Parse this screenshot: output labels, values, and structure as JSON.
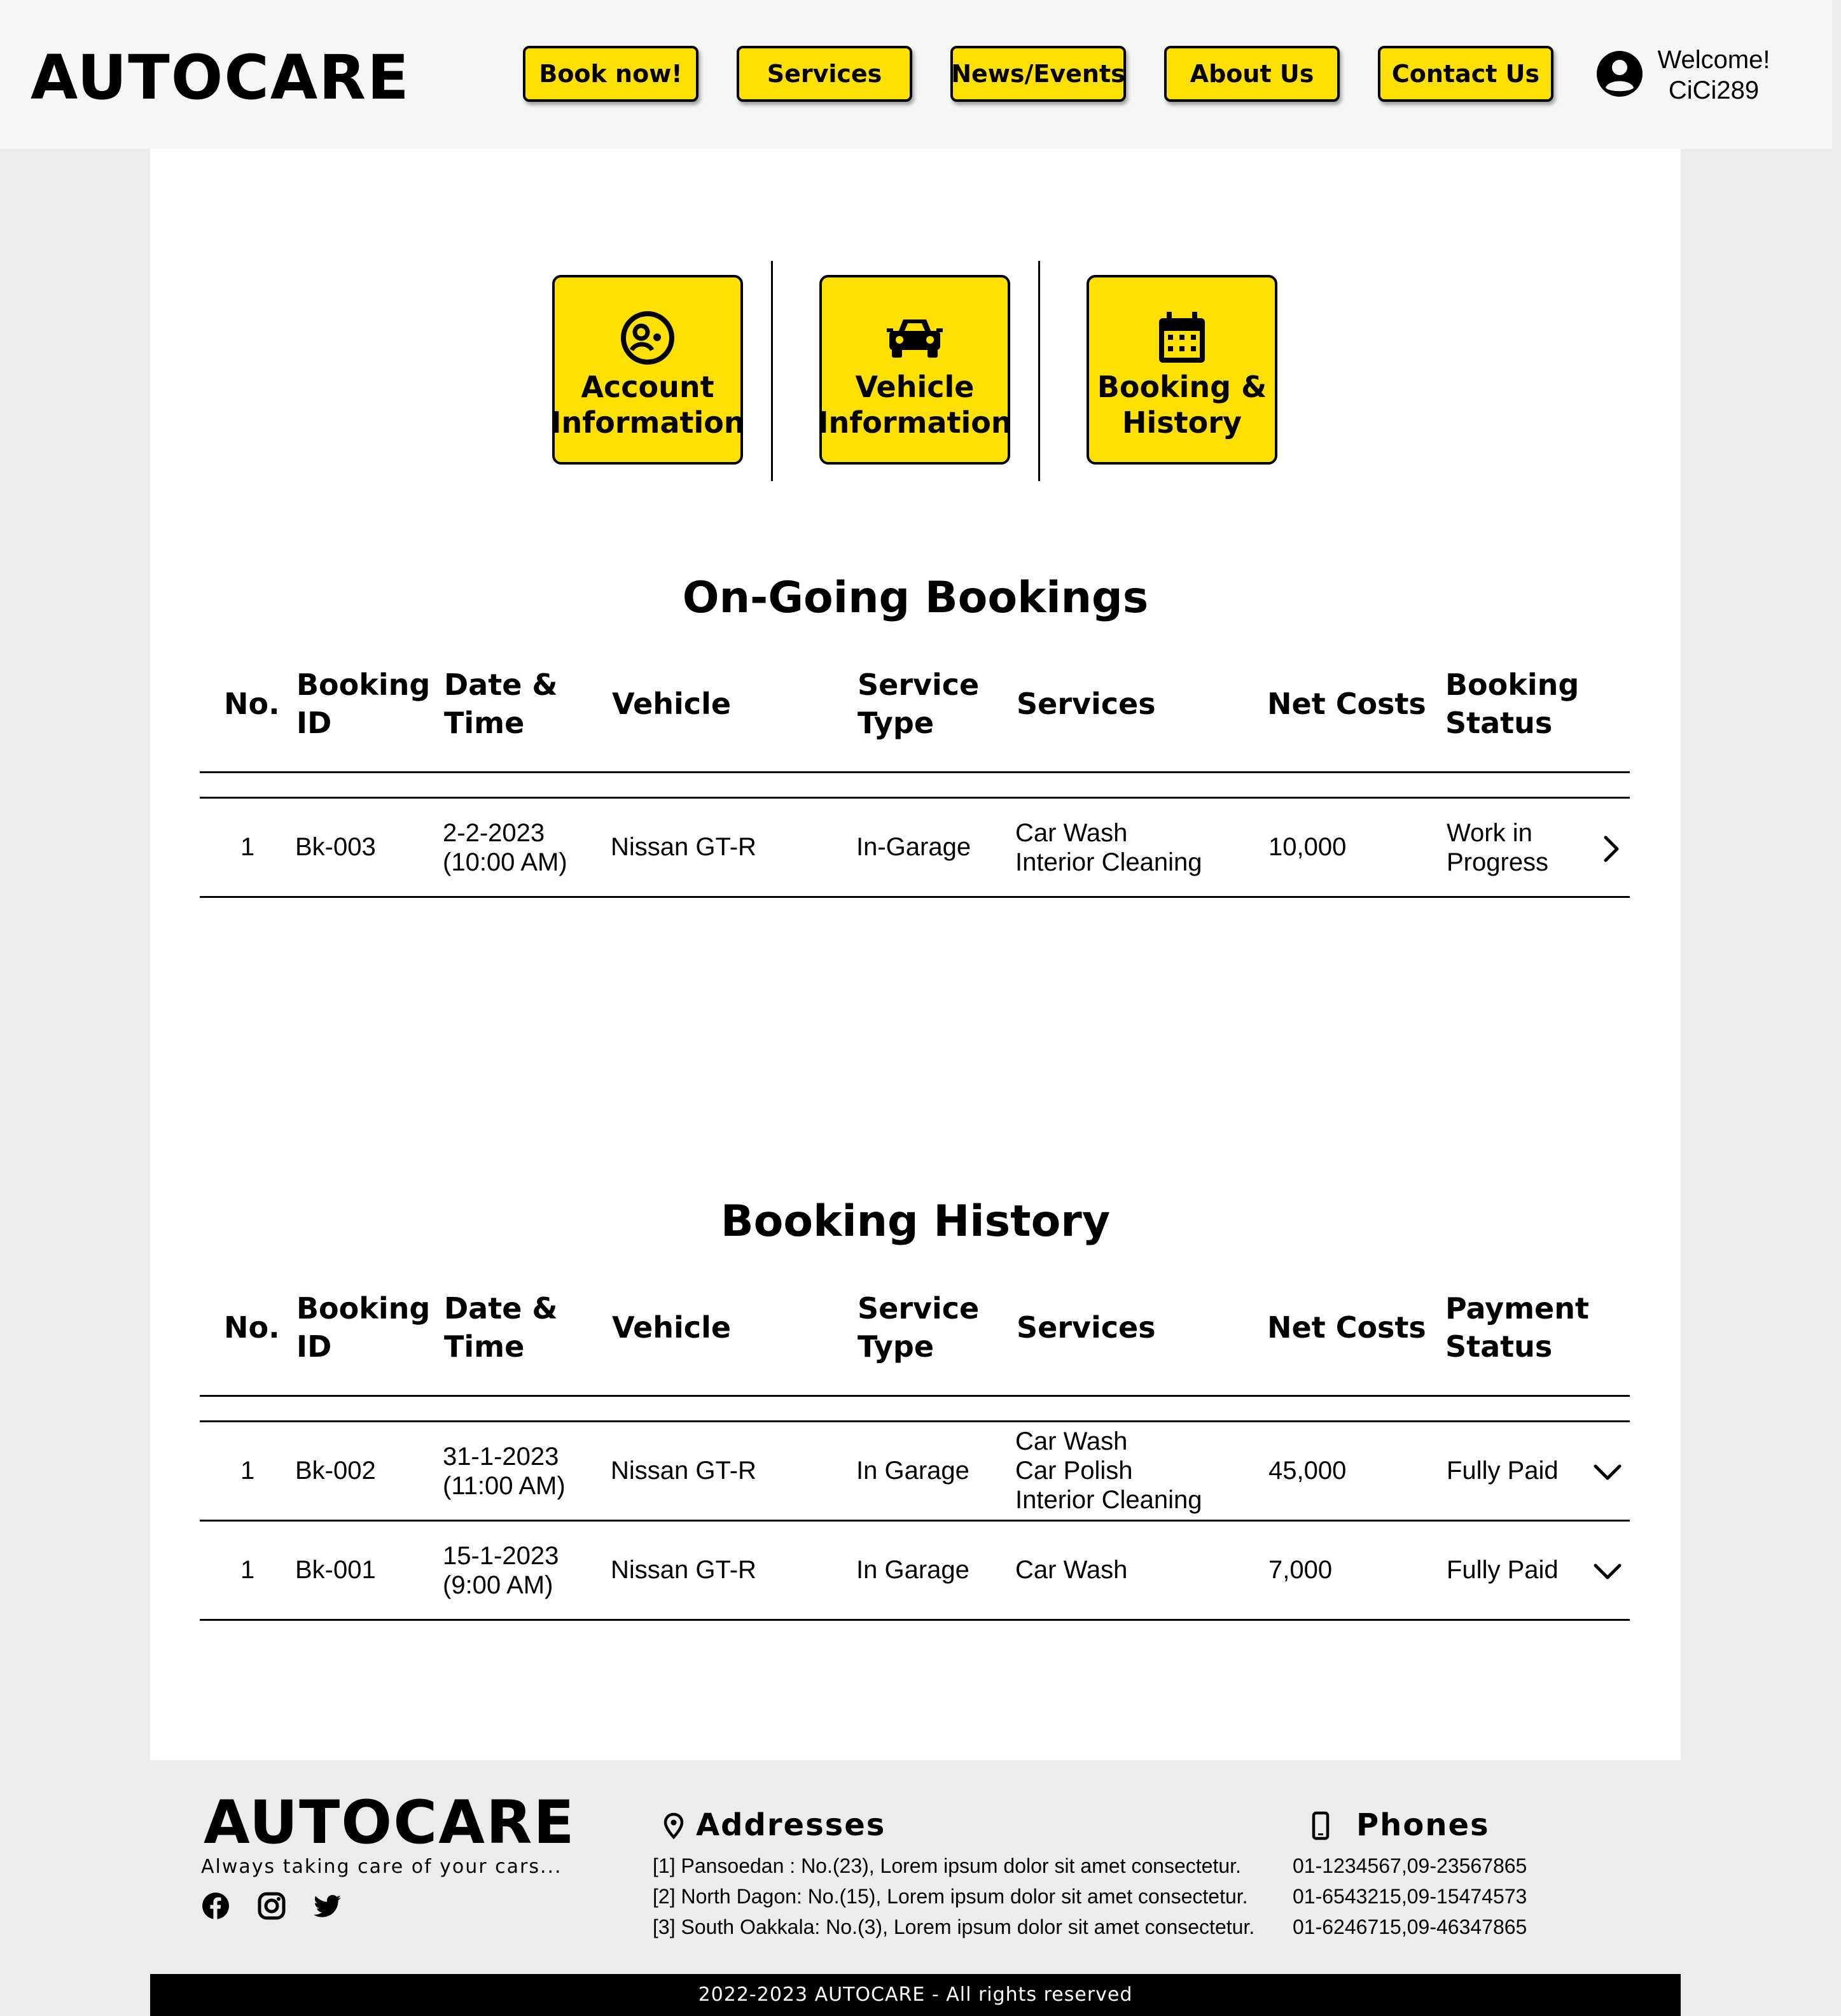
{
  "header": {
    "logo": "AUTOCARE",
    "nav": [
      "Book now!",
      "Services",
      "News/Events",
      "About Us",
      "Contact Us"
    ],
    "welcome": "Welcome!",
    "username": "CiCi289"
  },
  "tiles": [
    {
      "icon": "account-icon",
      "line1": "Account",
      "line2": "Information"
    },
    {
      "icon": "car-icon",
      "line1": "Vehicle",
      "line2": "Information"
    },
    {
      "icon": "calendar-icon",
      "line1": "Booking &",
      "line2": "History"
    }
  ],
  "ongoing": {
    "title": "On-Going Bookings",
    "headers": {
      "no": "No.",
      "booking_id": [
        "Booking",
        "ID"
      ],
      "date_time": [
        "Date &",
        "Time"
      ],
      "vehicle": "Vehicle",
      "service_type": [
        "Service",
        "Type"
      ],
      "services": "Services",
      "net_costs": "Net Costs",
      "status": [
        "Booking",
        "Status"
      ]
    },
    "rows": [
      {
        "no": "1",
        "booking_id": "Bk-003",
        "date": "2-2-2023",
        "time": "(10:00 AM)",
        "vehicle": "Nissan GT-R",
        "service_type": "In-Garage",
        "services": [
          "Car Wash",
          "Interior Cleaning"
        ],
        "net_cost": "10,000",
        "status": [
          "Work in",
          "Progress"
        ],
        "action_icon": "chevron-right-icon"
      }
    ]
  },
  "history": {
    "title": "Booking History",
    "headers": {
      "no": "No.",
      "booking_id": [
        "Booking",
        "ID"
      ],
      "date_time": [
        "Date &",
        "Time"
      ],
      "vehicle": "Vehicle",
      "service_type": [
        "Service",
        "Type"
      ],
      "services": "Services",
      "net_costs": "Net Costs",
      "status": [
        "Payment",
        "Status"
      ]
    },
    "rows": [
      {
        "no": "1",
        "booking_id": "Bk-002",
        "date": "31-1-2023",
        "time": "(11:00 AM)",
        "vehicle": "Nissan GT-R",
        "service_type": "In Garage",
        "services": [
          "Car Wash",
          "Car Polish",
          "Interior Cleaning"
        ],
        "net_cost": "45,000",
        "status": "Fully Paid",
        "action_icon": "chevron-down-icon"
      },
      {
        "no": "1",
        "booking_id": "Bk-001",
        "date": "15-1-2023",
        "time": "(9:00 AM)",
        "vehicle": "Nissan GT-R",
        "service_type": "In Garage",
        "services": [
          "Car Wash"
        ],
        "net_cost": "7,000",
        "status": "Fully Paid",
        "action_icon": "chevron-down-icon"
      }
    ]
  },
  "footer": {
    "logo": "AUTOCARE",
    "tagline": "Always taking care of your cars...",
    "social_icons": [
      "facebook-icon",
      "instagram-icon",
      "twitter-icon"
    ],
    "addresses_title": "Addresses",
    "addresses": [
      "[1] Pansoedan : No.(23), Lorem ipsum dolor sit amet consectetur.",
      "[2] North Dagon: No.(15), Lorem ipsum dolor sit amet consectetur.",
      "[3] South Oakkala: No.(3), Lorem ipsum dolor sit amet consectetur."
    ],
    "phones_title": "Phones",
    "phones": [
      "01-1234567,09-23567865",
      "01-6543215,09-15474573",
      "01-6246715,09-46347865"
    ],
    "copyright": "2022-2023 AUTOCARE - All rights reserved"
  },
  "colors": {
    "accent": "#ffe000",
    "header_bg": "#f6f6f6",
    "page_bg": "#ececec",
    "footer_bar": "#000000"
  }
}
